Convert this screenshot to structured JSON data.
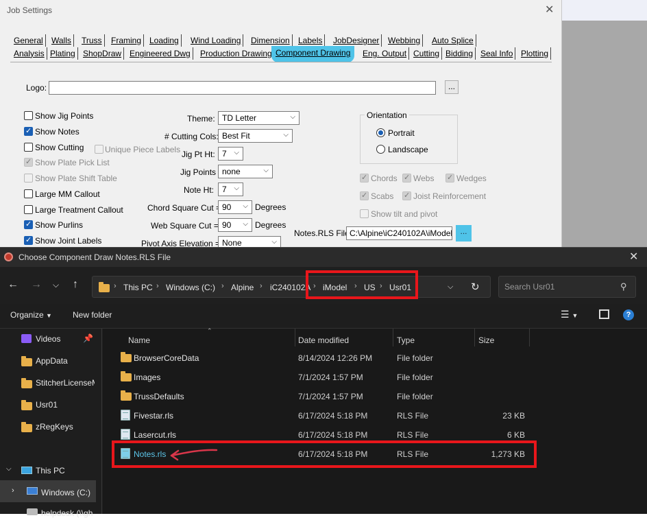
{
  "job": {
    "title": "Job Settings",
    "close": "✕",
    "tabs_row1": [
      "General",
      "Walls",
      "Truss",
      "Framing",
      "Loading",
      "Wind Loading",
      "Dimension",
      "Labels",
      "JobDesigner",
      "Webbing",
      "Auto Splice"
    ],
    "tabs_row2": [
      "Analysis",
      "Plating",
      "ShopDraw",
      "Engineered Dwg",
      "Production Drawing",
      "Component Drawing",
      "Eng. Output",
      "Cutting",
      "Bidding",
      "Seal Info",
      "Plotting"
    ],
    "logo_label": "Logo:",
    "logo_value": "",
    "browse": "...",
    "checkboxes": [
      {
        "label": "Show Jig Points",
        "checked": false,
        "disabled": false
      },
      {
        "label": "Show Notes",
        "checked": true,
        "disabled": false
      },
      {
        "label": "Show Cutting",
        "checked": false,
        "disabled": false
      },
      {
        "label": "Show Plate Pick List",
        "checked": true,
        "disabled": true
      },
      {
        "label": "Show Plate Shift Table",
        "checked": false,
        "disabled": true
      },
      {
        "label": "Large MM Callout",
        "checked": false,
        "disabled": false
      },
      {
        "label": "Large Treatment Callout",
        "checked": false,
        "disabled": false
      },
      {
        "label": "Show Purlins",
        "checked": true,
        "disabled": false
      },
      {
        "label": "Show Joint Labels",
        "checked": true,
        "disabled": false
      }
    ],
    "unique_piece_labels": "Unique Piece Labels",
    "theme_label": "Theme:",
    "theme_value": "TD Letter",
    "cutting_cols_label": "# Cutting Cols:",
    "cutting_cols_value": "Best Fit",
    "jig_pt_ht_label": "Jig Pt Ht:",
    "jig_pt_ht_value": "7",
    "jig_points_label": "Jig Points",
    "jig_points_value": "none",
    "note_ht_label": "Note Ht:",
    "note_ht_value": "7",
    "chord_sq_label": "Chord Square Cut =",
    "chord_sq_value": "90",
    "web_sq_label": "Web Square Cut =",
    "web_sq_value": "90",
    "degrees": "Degrees",
    "pivot_label": "Pivot Axis Elevation =",
    "pivot_value": "None",
    "orientation_title": "Orientation",
    "portrait": "Portrait",
    "landscape": "Landscape",
    "chords": "Chords",
    "webs": "Webs",
    "wedges": "Wedges",
    "scabs": "Scabs",
    "joist_reinforcement": "Joist Reinforcement",
    "show_tilt": "Show tilt and pivot",
    "notes_rls_label": "Notes.RLS File",
    "notes_rls_value": "C:\\Alpine\\iC240102A\\iModel\\U:"
  },
  "dialog": {
    "title": "Choose Component Draw Notes.RLS File",
    "close": "✕",
    "breadcrumbs": [
      "This PC",
      "Windows (C:)",
      "Alpine",
      "iC240102A",
      "iModel",
      "US",
      "Usr01"
    ],
    "search_placeholder": "Search Usr01",
    "organize": "Organize",
    "new_folder": "New folder",
    "sidebar": [
      "Videos",
      "AppData",
      "StitcherLicenseM",
      "Usr01",
      "zRegKeys",
      "This PC",
      "Windows (C:)",
      "helpdesk (\\\\gh"
    ],
    "columns": [
      "Name",
      "Date modified",
      "Type",
      "Size"
    ],
    "files": [
      {
        "name": "BrowserCoreData",
        "date": "8/14/2024 12:26 PM",
        "type": "File folder",
        "size": "",
        "kind": "folder"
      },
      {
        "name": "Images",
        "date": "7/1/2024 1:57 PM",
        "type": "File folder",
        "size": "",
        "kind": "folder"
      },
      {
        "name": "TrussDefaults",
        "date": "7/1/2024 1:57 PM",
        "type": "File folder",
        "size": "",
        "kind": "folder"
      },
      {
        "name": "Fivestar.rls",
        "date": "6/17/2024 5:18 PM",
        "type": "RLS File",
        "size": "23 KB",
        "kind": "file"
      },
      {
        "name": "Lasercut.rls",
        "date": "6/17/2024 5:18 PM",
        "type": "RLS File",
        "size": "6 KB",
        "kind": "file"
      },
      {
        "name": "Notes.rls",
        "date": "6/17/2024 5:18 PM",
        "type": "RLS File",
        "size": "1,273 KB",
        "kind": "file"
      }
    ]
  },
  "colors": {
    "highlight": "#e8161b",
    "accent": "#4fc3e8",
    "selected_link": "#4fc3e8"
  }
}
